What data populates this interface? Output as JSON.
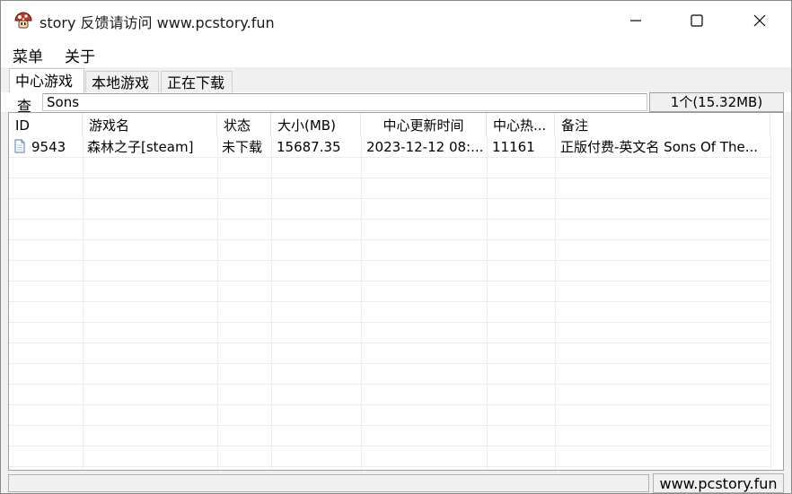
{
  "window": {
    "title": "story 反馈请访问 www.pcstory.fun"
  },
  "menu": {
    "items": [
      {
        "label": "菜单"
      },
      {
        "label": "关于"
      }
    ]
  },
  "tabs": [
    {
      "label": "中心游戏",
      "active": true
    },
    {
      "label": "本地游戏",
      "active": false
    },
    {
      "label": "正在下载",
      "active": false
    }
  ],
  "search": {
    "label": "查",
    "value": "Sons",
    "result_count": "1个(15.32MB)"
  },
  "table": {
    "columns": [
      {
        "label": "ID"
      },
      {
        "label": "游戏名"
      },
      {
        "label": "状态"
      },
      {
        "label": "大小(MB)"
      },
      {
        "label": "中心更新时间"
      },
      {
        "label": "中心热..."
      },
      {
        "label": "备注"
      }
    ],
    "sort_indicator": "^",
    "rows": [
      {
        "id": "9543",
        "name": "森林之子[steam]",
        "status": "未下载",
        "size": "15687.35",
        "updated": "2023-12-12 08:...",
        "heat": "11161",
        "note": "正版付费-英文名 Sons Of The..."
      }
    ]
  },
  "statusbar": {
    "right_text": "www.pcstory.fun"
  },
  "colors": {
    "window_bg": "#f0f0f0",
    "border": "#a0a0a0",
    "icon_red": "#c0392b"
  }
}
